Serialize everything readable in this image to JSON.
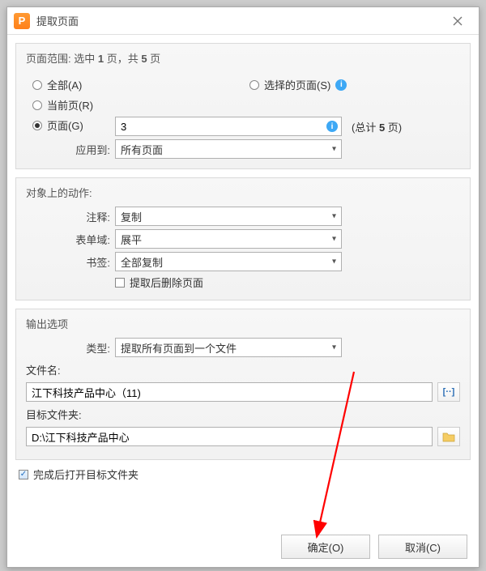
{
  "title": "提取页面",
  "pageRange": {
    "headerPrefix": "页面范围: 选中 ",
    "selectedCount": "1",
    "headerMid": " 页，共 ",
    "totalCount": "5",
    "headerSuffix": " 页",
    "radioAll": "全部(A)",
    "radioSelected": "选择的页面(S)",
    "radioCurrent": "当前页(R)",
    "radioPages": "页面(G)",
    "pagesValue": "3",
    "pagesTotalPrefix": "(总计 ",
    "pagesTotalCount": "5",
    "pagesTotalSuffix": " 页)",
    "applyLabel": "应用到:",
    "applyValue": "所有页面"
  },
  "actions": {
    "header": "对象上的动作:",
    "commentLabel": "注释:",
    "commentValue": "复制",
    "formLabel": "表单域:",
    "formValue": "展平",
    "bookmarkLabel": "书签:",
    "bookmarkValue": "全部复制",
    "deleteAfter": "提取后删除页面"
  },
  "output": {
    "header": "输出选项",
    "typeLabel": "类型:",
    "typeValue": "提取所有页面到一个文件",
    "fileNameLabel": "文件名:",
    "fileNameValue": "江下科技产品中心（11)",
    "folderLabel": "目标文件夹:",
    "folderValue": "D:\\江下科技产品中心",
    "openAfter": "完成后打开目标文件夹"
  },
  "buttons": {
    "ok": "确定(O)",
    "cancel": "取消(C)"
  }
}
